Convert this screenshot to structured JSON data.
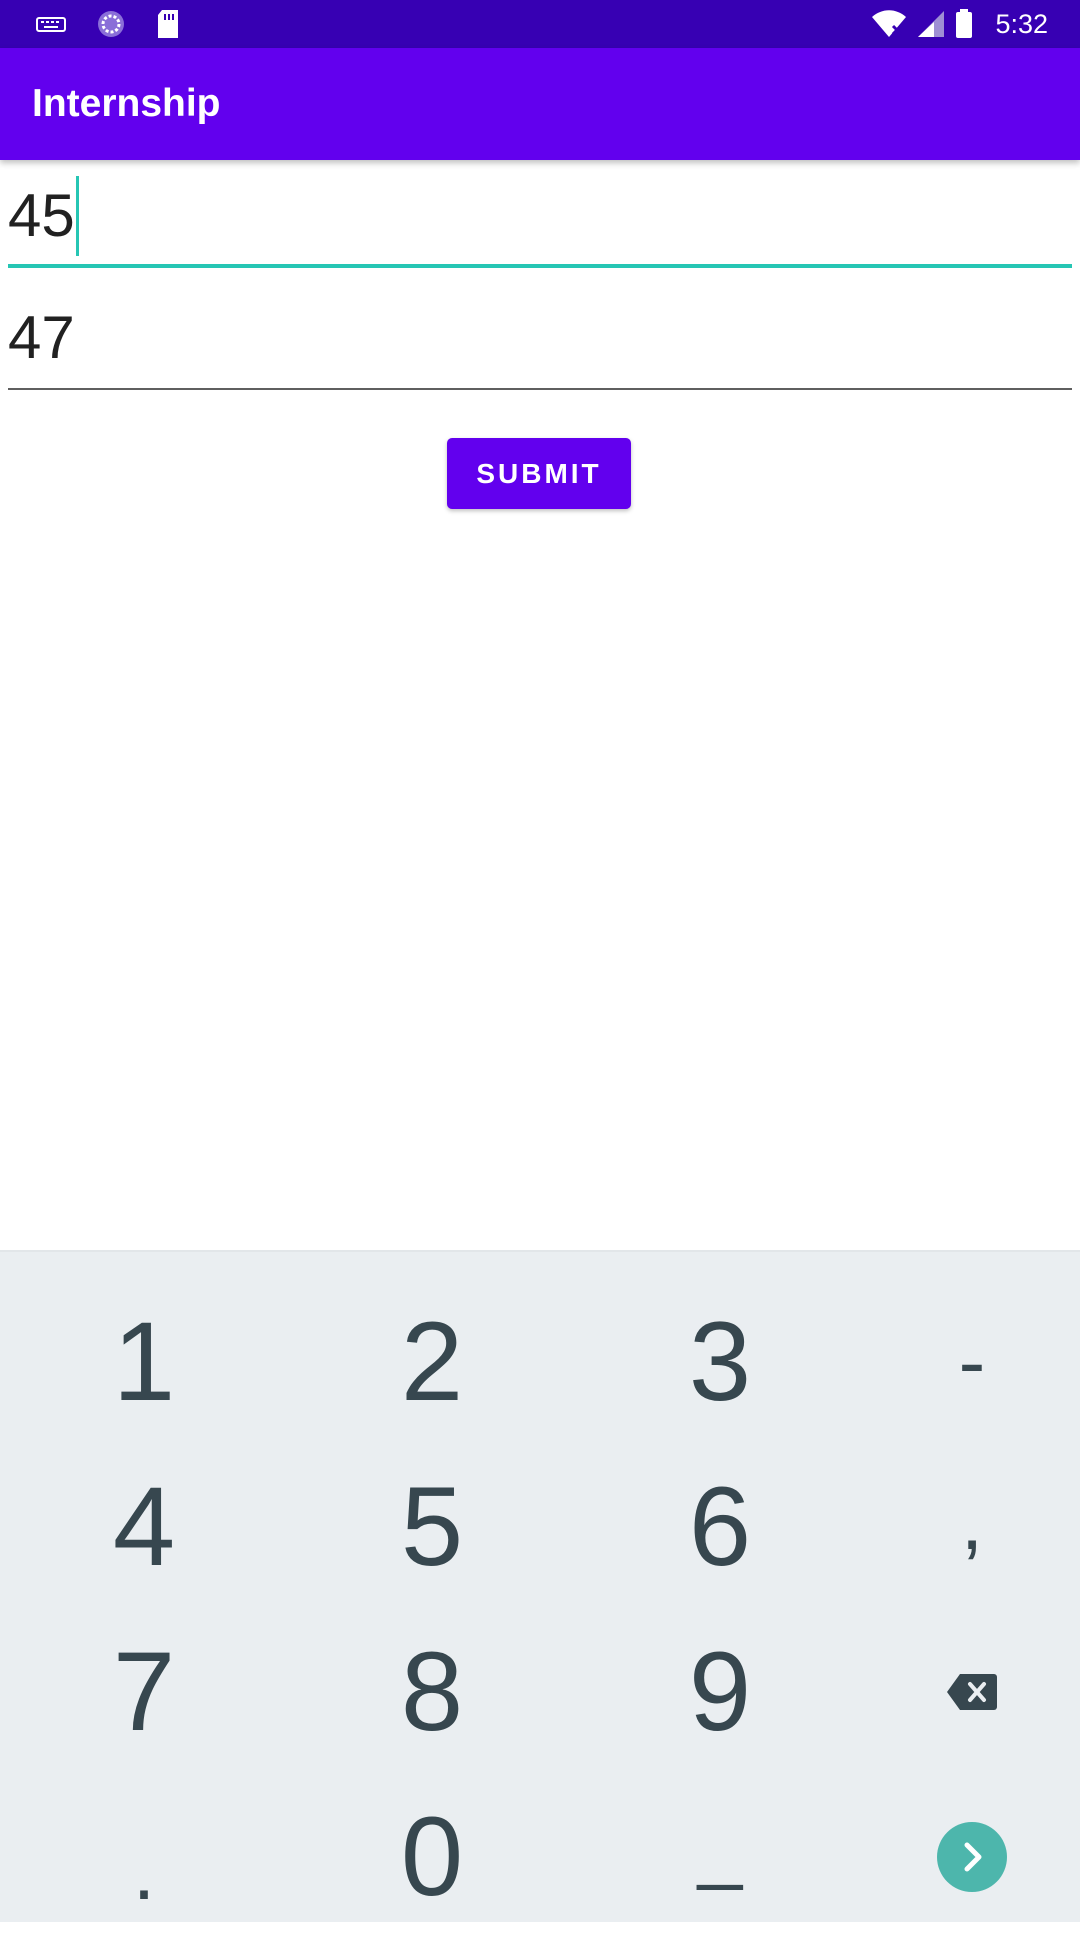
{
  "status_bar": {
    "time": "5:32",
    "icons": [
      "keyboard-icon",
      "sync-icon",
      "sd-card-icon",
      "wifi-off-icon",
      "signal-icon",
      "battery-icon"
    ]
  },
  "app_bar": {
    "title": "Internship"
  },
  "form": {
    "field1_value": "45",
    "field2_value": "47",
    "submit_label": "SUBMIT"
  },
  "keypad": {
    "keys": [
      "1",
      "2",
      "3",
      "-",
      "4",
      "5",
      "6",
      ",",
      "7",
      "8",
      "9",
      ".",
      "0",
      "_"
    ],
    "special_icons": [
      "backspace-icon",
      "next-icon"
    ]
  },
  "colors": {
    "status_bar": "#3700b3",
    "app_bar": "#6200ee",
    "accent": "#26c6b4",
    "keypad_bg": "#eaeef1",
    "key_text": "#37474f",
    "enter_button": "#4db6ac"
  }
}
